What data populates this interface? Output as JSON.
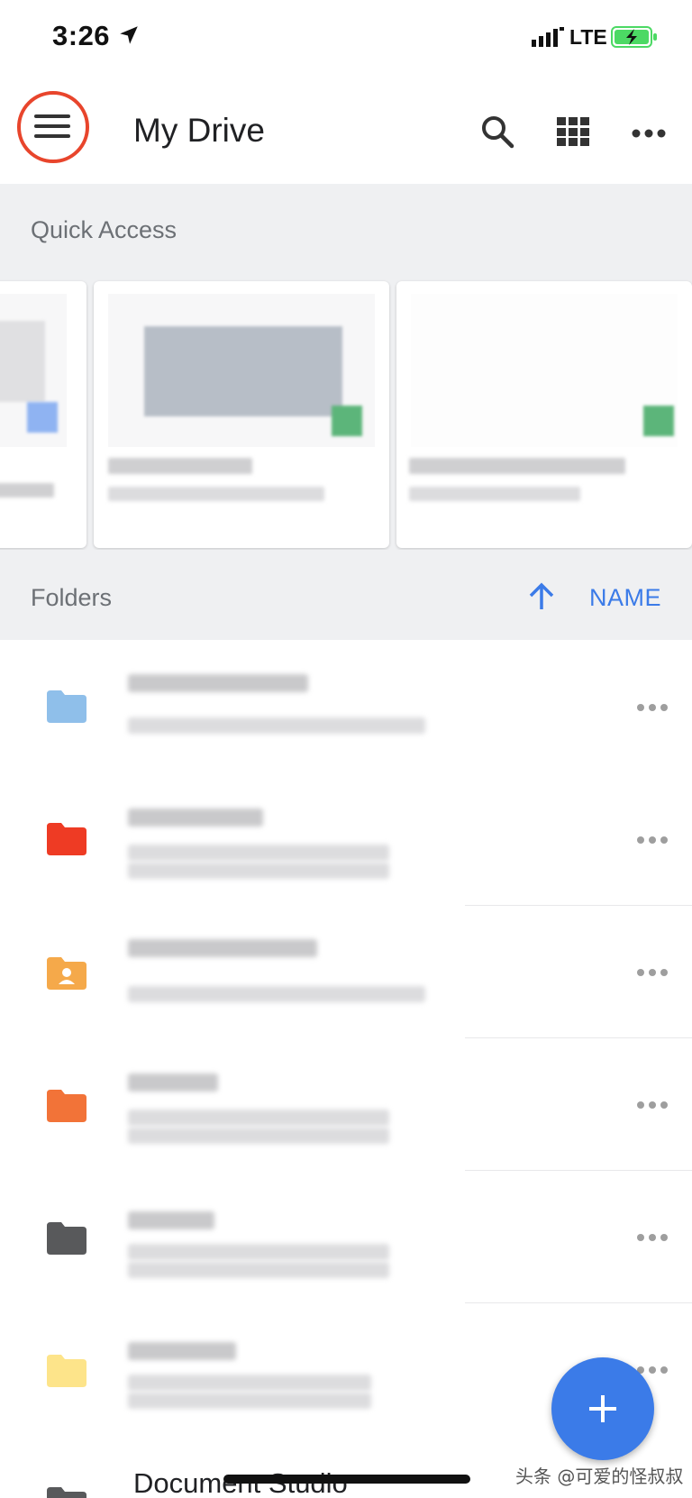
{
  "status_bar": {
    "time": "3:26",
    "network": "LTE",
    "location_icon": "location-arrow-icon",
    "battery_icon": "battery-charging-icon"
  },
  "app_bar": {
    "title": "My Drive",
    "menu_icon": "hamburger-menu-icon",
    "search_icon": "search-icon",
    "view_icon": "grid-view-icon",
    "more_icon": "more-horizontal-icon",
    "highlight_color": "#e8452c"
  },
  "quick_access": {
    "label": "Quick Access"
  },
  "folders": {
    "label": "Folders",
    "sort_label": "NAME",
    "sort_icon": "arrow-up-icon",
    "items": [
      {
        "color": "#8fbfea",
        "icon": "folder-icon"
      },
      {
        "color": "#ee3b24",
        "icon": "folder-icon"
      },
      {
        "color": "#f5a94a",
        "icon": "shared-folder-icon"
      },
      {
        "color": "#f27338",
        "icon": "folder-icon"
      },
      {
        "color": "#58595b",
        "icon": "folder-icon"
      },
      {
        "color": "#fde48a",
        "icon": "folder-icon"
      },
      {
        "color": "#58595b",
        "icon": "folder-icon",
        "name": "Document Studio"
      }
    ]
  },
  "fab": {
    "icon": "plus-icon",
    "color": "#3b7be8"
  },
  "watermark": "头条 @可爱的怪叔叔"
}
